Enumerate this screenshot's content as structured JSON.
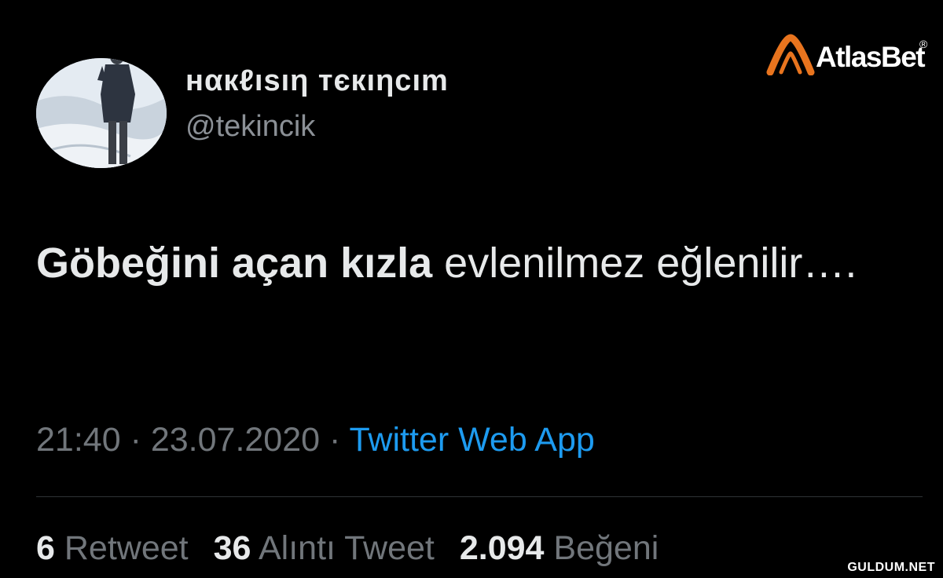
{
  "profile": {
    "display_name": "нαкℓısıη тєкıηcım",
    "handle": "@tekincik"
  },
  "brand": {
    "name": "AtlasBet",
    "registered_mark": "®",
    "colors": {
      "mark": "#e8741e",
      "text": "#ffffff"
    }
  },
  "tweet": {
    "bold_text": "Göbeğini açan kızla",
    "normal_text": "evlenilmez eğlenilir…."
  },
  "meta": {
    "time": "21:40",
    "separator": "·",
    "date": "23.07.2020",
    "source": "Twitter Web App"
  },
  "stats": {
    "retweets_count": "6",
    "retweets_label": "Retweet",
    "quotes_count": "36",
    "quotes_label": "Alıntı Tweet",
    "likes_count": "2.094",
    "likes_label": "Beğeni"
  },
  "watermark": "GULDUM.NET",
  "colors": {
    "background": "#000000",
    "primary_text": "#e7e9ea",
    "secondary_text": "#71767b",
    "link": "#1d9bf0",
    "divider": "#2f3336"
  }
}
